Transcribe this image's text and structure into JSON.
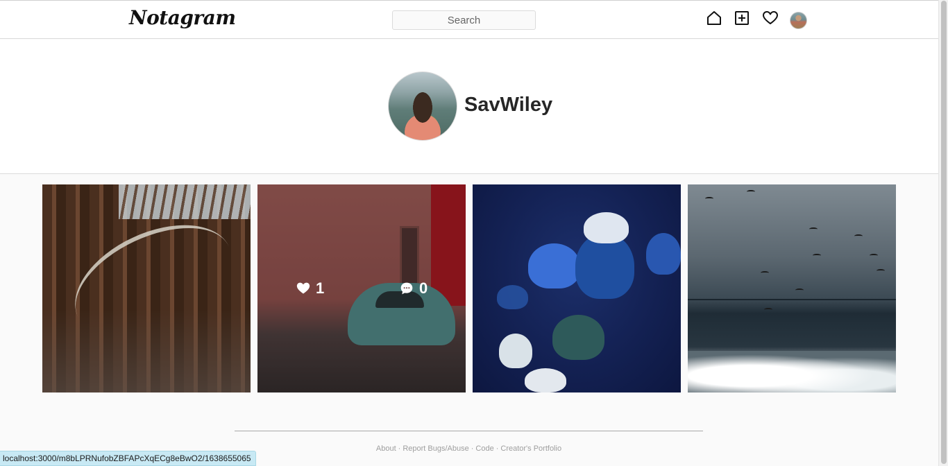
{
  "app": {
    "logo": "Notagram"
  },
  "topbar": {
    "search_placeholder": "Search",
    "icons": [
      "home-icon",
      "add-post-icon",
      "heart-icon",
      "avatar"
    ]
  },
  "profile": {
    "username": "SavWiley"
  },
  "posts": [
    {
      "subject": "whale skeleton in museum hall"
    },
    {
      "subject": "teal beetle car on cobbled street",
      "likes": "1",
      "comments": "0"
    },
    {
      "subject": "blue jellyfish"
    },
    {
      "subject": "seagulls over stormy sea"
    }
  ],
  "footer": {
    "links": [
      "About",
      "Report Bugs/Abuse",
      "Code",
      "Creator's Portfolio"
    ],
    "separator": "·"
  },
  "status_bar": {
    "url": "localhost:3000/m8bLPRNufobZBFAPcXqECg8eBwO2/1638655065"
  },
  "colors": {
    "link_hover_bg": "#c8e9f4",
    "text": "#262626",
    "muted": "#9e9e9e"
  }
}
